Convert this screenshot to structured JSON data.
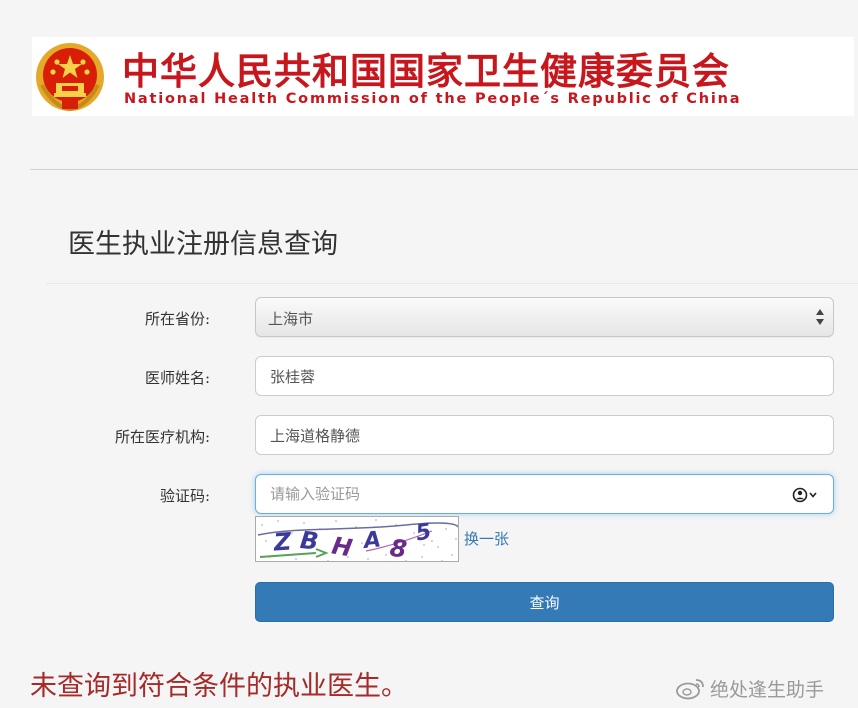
{
  "banner": {
    "title_cn": "中华人民共和国国家卫生健康委员会",
    "title_en": "National Health Commission of the People´s Republic of China",
    "emblem_icon": "national-emblem-icon",
    "color": "#c8161d"
  },
  "page": {
    "title": "医生执业注册信息查询"
  },
  "form": {
    "province": {
      "label": "所在省份:",
      "value": "上海市",
      "icon": "select-arrows-icon"
    },
    "doctor_name": {
      "label": "医师姓名:",
      "value": "张桂蓉"
    },
    "institution": {
      "label": "所在医疗机构:",
      "value": "上海道格静德"
    },
    "captcha": {
      "label": "验证码:",
      "placeholder": "请输入验证码",
      "value": "",
      "image_text": "ZBHA85",
      "refresh_label": "换一张",
      "icon": "password-manager-icon"
    },
    "submit_label": "查询",
    "submit_color": "#337ab7"
  },
  "result": {
    "message": "未查询到符合条件的执业医生。",
    "color": "#a52a2a"
  },
  "watermark": {
    "text": "绝处逢生助手",
    "icon": "weibo-icon"
  }
}
